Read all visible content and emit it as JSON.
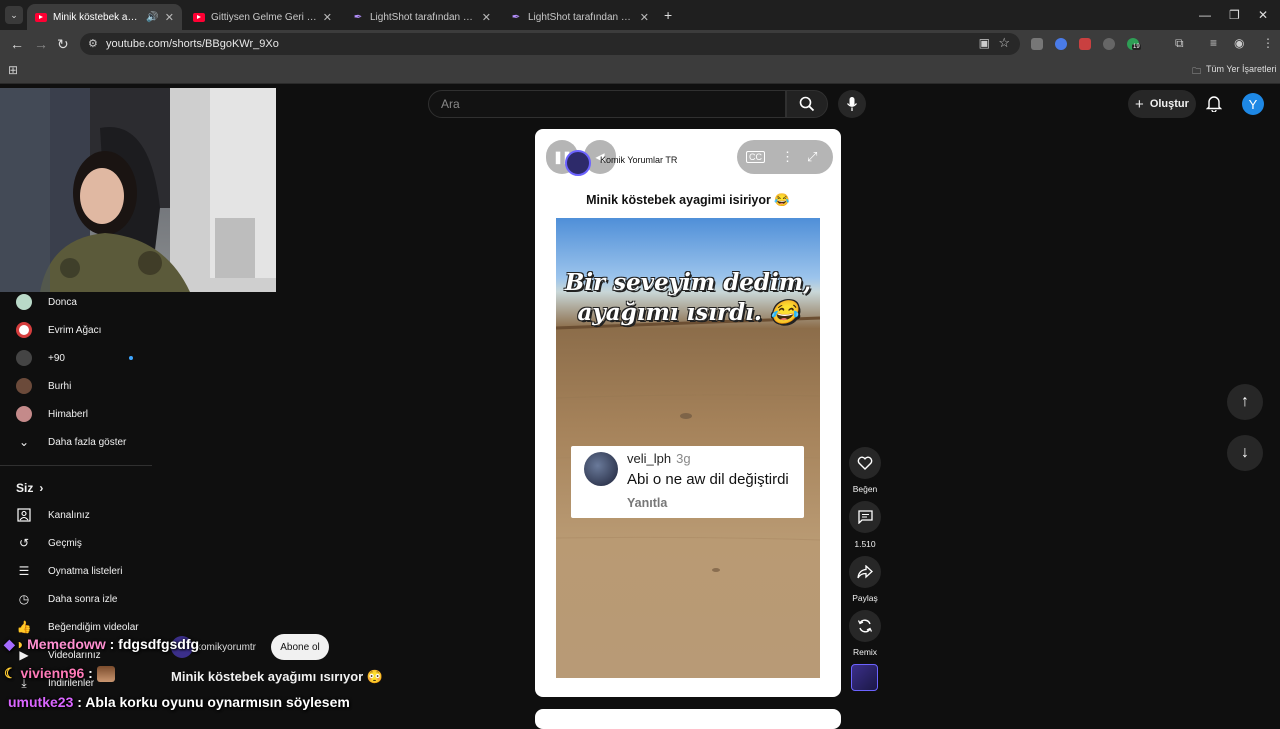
{
  "browser": {
    "tabs": [
      {
        "title": "Minik köstebek ayağımı ısırıy",
        "icon": "youtube-icon",
        "audio": "speaker-icon"
      },
      {
        "title": "Gittiysen Gelme Geri Kedi Versi",
        "icon": "youtube-icon"
      },
      {
        "title": "LightShot tarafından Ekran Görü",
        "icon": "feather-icon"
      },
      {
        "title": "LightShot tarafından Ekran Görü",
        "icon": "feather-icon"
      }
    ],
    "url": "youtube.com/shorts/BBgoKWr_9Xo",
    "bookmarks_label": "Tüm Yer İşaretleri",
    "extension_badge": "19"
  },
  "youtube": {
    "search_placeholder": "Ara",
    "create_label": "Oluştur",
    "avatar_letter": "Y"
  },
  "sidebar": {
    "subscriptions": [
      {
        "label": "Donca",
        "color": "#b9d9c8"
      },
      {
        "label": "Evrim Ağacı",
        "color": "#d63e3e"
      },
      {
        "label": "+90",
        "color": "#444444"
      },
      {
        "label": "Burhi",
        "color": "#6b4a3a"
      },
      {
        "label": "Himaberl",
        "color": "#c48a8a"
      }
    ],
    "show_more": "Daha fazla göster",
    "you_heading": "Siz",
    "you_items": [
      {
        "label": "Kanalınız",
        "icon": "channel-icon"
      },
      {
        "label": "Geçmiş",
        "icon": "history-icon"
      },
      {
        "label": "Oynatma listeleri",
        "icon": "playlist-icon"
      },
      {
        "label": "Daha sonra izle",
        "icon": "watch-later-icon"
      },
      {
        "label": "Beğendiğim videolar",
        "icon": "thumb-up-icon"
      },
      {
        "label": "Videolarınız",
        "icon": "your-videos-icon"
      },
      {
        "label": "İndirilenler",
        "icon": "download-icon"
      }
    ]
  },
  "short": {
    "channel_name": "Komik Yorumlar TR",
    "title": "Minik köstebek ayagimi isiriyor 😂",
    "caption_line1": "Bir seveyim dedim,",
    "caption_line2": "ayağımı ısırdı. 😂",
    "comment": {
      "user": "veli_lph",
      "time": "3g",
      "text": "Abi o ne aw dil değiştirdi",
      "reply": "Yanıtla"
    },
    "overlay_channel": "komikyorumtr",
    "subscribe_label": "Abone ol",
    "overlay_title": "Minik köstebek ayağımı ısırıyor 😳",
    "actions": {
      "like": "Beğen",
      "comments": "1.510",
      "share": "Paylaş",
      "remix": "Remix"
    }
  },
  "chat": [
    {
      "user": "Memedoww",
      "user_color": "#ff8fd0",
      "message": "fdgsdfgsdfg"
    },
    {
      "user": "vivienn96",
      "user_color": "#ff7ab8",
      "message": ""
    },
    {
      "user": "umutke23",
      "user_color": "#d966ff",
      "message": "Abla korku oyunu oynarmısın söylesem"
    }
  ]
}
